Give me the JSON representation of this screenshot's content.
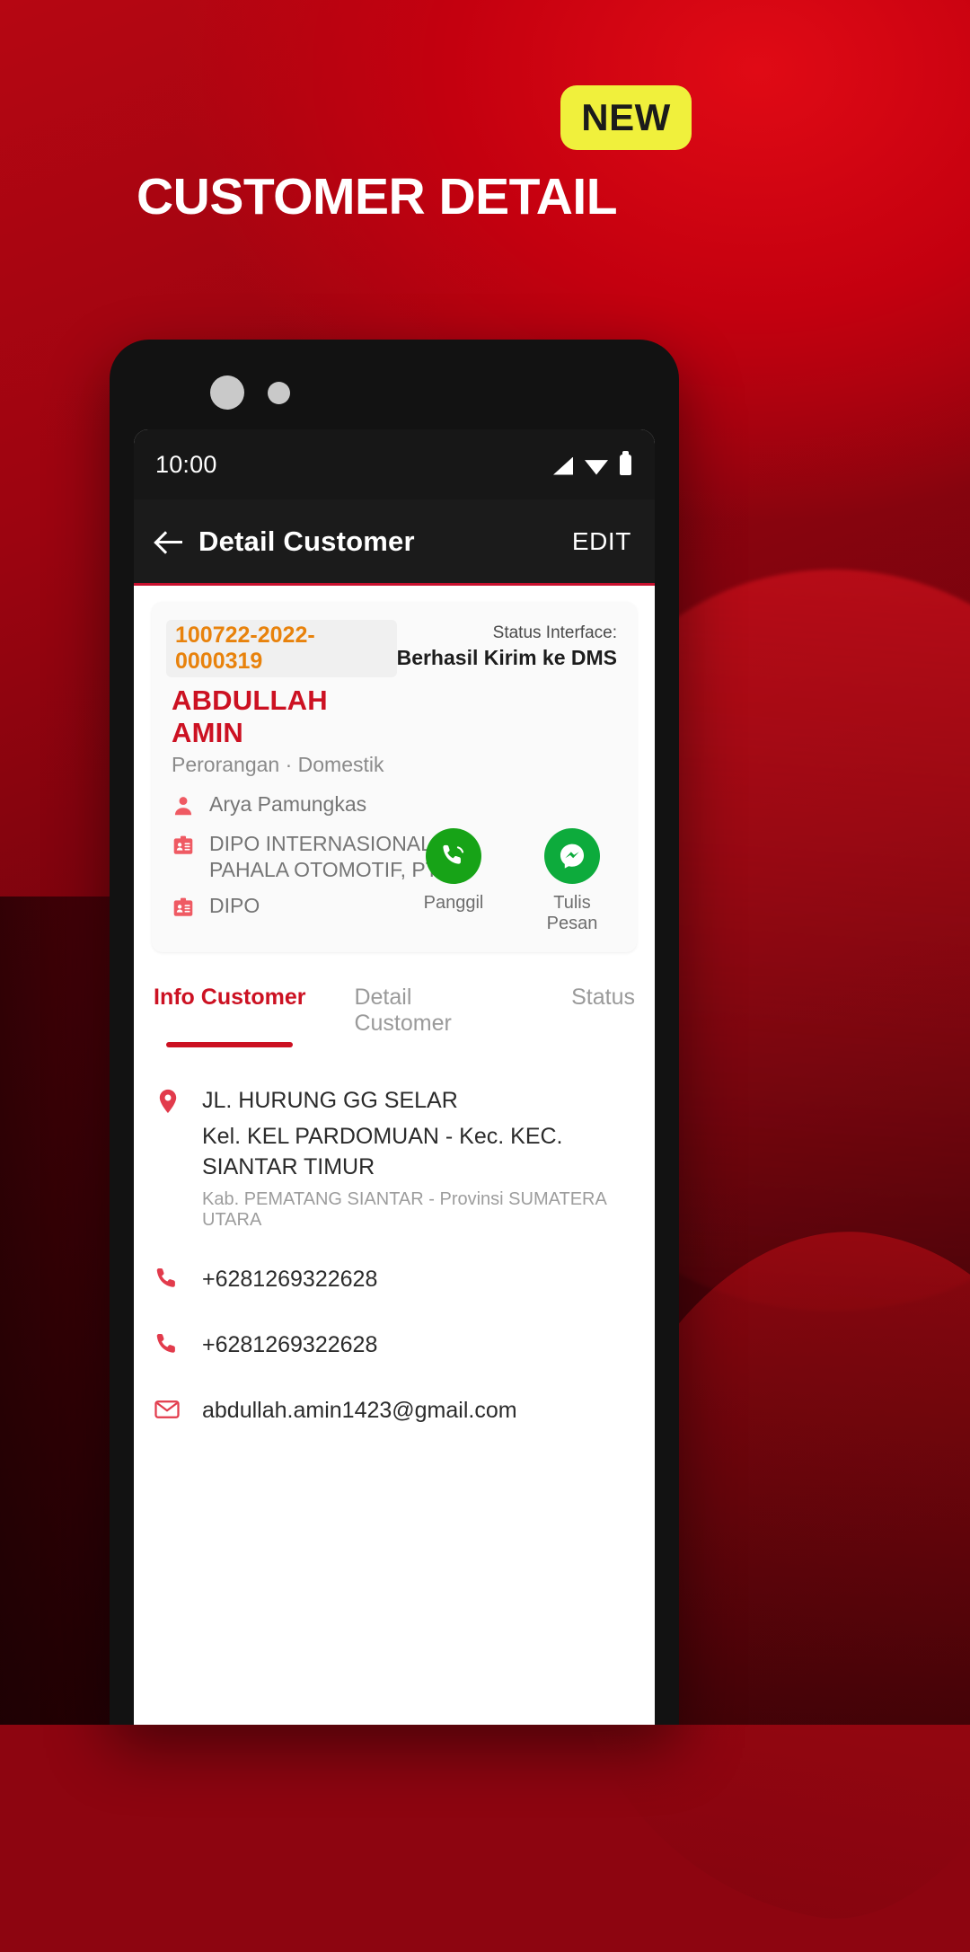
{
  "promo": {
    "badge": "NEW",
    "headline": "CUSTOMER DETAIL",
    "badge_color": "#f0f03c",
    "brand_red": "#cc1122"
  },
  "phone": {
    "statusbar": {
      "time": "10:00",
      "icons": [
        "signal-icon",
        "wifi-icon",
        "battery-icon"
      ]
    },
    "appbar": {
      "back": "back-arrow-icon",
      "title": "Detail Customer",
      "action": "EDIT"
    },
    "card": {
      "customer_id": "100722-2022-0000319",
      "name": "ABDULLAH AMIN",
      "subtitle": "Perorangan · Domestik",
      "status_label": "Status Interface:",
      "status_value": "Berhasil Kirim ke DMS",
      "meta": [
        {
          "icon": "person-icon",
          "text": "Arya Pamungkas"
        },
        {
          "icon": "id-card-icon",
          "text": "DIPO INTERNASIONAL PAHALA OTOMOTIF, PT"
        },
        {
          "icon": "id-card-icon",
          "text": "DIPO"
        }
      ],
      "actions": [
        {
          "icon": "phone-call-icon",
          "label": "Panggil",
          "color": "#17a317"
        },
        {
          "icon": "messenger-icon",
          "label": "Tulis Pesan",
          "color": "#0dab3c"
        }
      ]
    },
    "tabs": [
      {
        "label": "Info Customer",
        "active": true
      },
      {
        "label": "Detail Customer",
        "active": false
      },
      {
        "label": "Status",
        "active": false
      }
    ],
    "info": {
      "address": {
        "icon": "location-pin-icon",
        "line1": "JL. HURUNG GG SELAR",
        "line2": "Kel. KEL PARDOMUAN - Kec. KEC. SIANTAR  TIMUR",
        "line3": "Kab. PEMATANG SIANTAR - Provinsi SUMATERA UTARA"
      },
      "contacts": [
        {
          "icon": "phone-icon",
          "text": "+6281269322628"
        },
        {
          "icon": "phone-icon",
          "text": "+6281269322628"
        },
        {
          "icon": "gmail-icon",
          "text": "abdullah.amin1423@gmail.com"
        }
      ]
    }
  }
}
